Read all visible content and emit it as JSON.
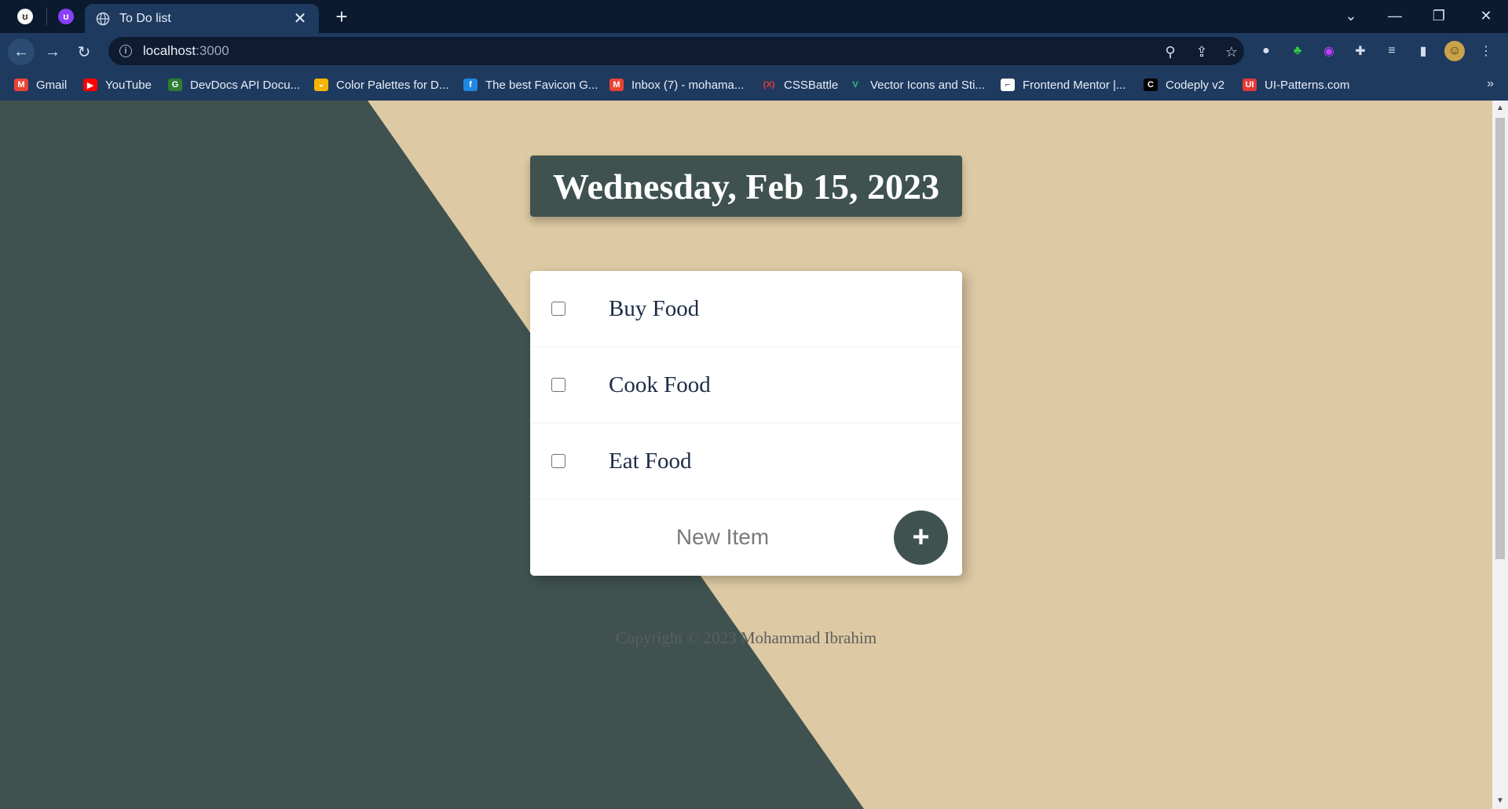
{
  "browser": {
    "tab_title": "To Do list",
    "url_host": "localhost",
    "url_port": ":3000",
    "bookmarks": [
      {
        "label": "Gmail",
        "icon": "gmail-icon",
        "color": "#ea4335"
      },
      {
        "label": "YouTube",
        "icon": "youtube-icon",
        "color": "#ff0000"
      },
      {
        "label": "DevDocs API Docu...",
        "icon": "devdocs-icon",
        "color": "#2e7d32"
      },
      {
        "label": "Color Palettes for D...",
        "icon": "color-palettes-icon",
        "color": "#f4b400"
      },
      {
        "label": "The best Favicon G...",
        "icon": "favicon-icon",
        "color": "#1e88e5"
      },
      {
        "label": "Inbox (7) - mohama...",
        "icon": "gmail-icon",
        "color": "#ea4335"
      },
      {
        "label": "CSSBattle",
        "icon": "cssbattle-icon",
        "color": "#e53935"
      },
      {
        "label": "Vector Icons and Sti...",
        "icon": "vector-icons-icon",
        "color": "#2ec27e"
      },
      {
        "label": "Frontend Mentor |...",
        "icon": "frontend-mentor-icon",
        "color": "#ffffff"
      },
      {
        "label": "Codeply v2",
        "icon": "codeply-icon",
        "color": "#000000"
      },
      {
        "label": "UI-Patterns.com",
        "icon": "ui-patterns-icon",
        "color": "#e53935"
      }
    ]
  },
  "page": {
    "date_title": "Wednesday, Feb 15, 2023",
    "items": [
      {
        "label": "Buy Food",
        "checked": false
      },
      {
        "label": "Cook Food",
        "checked": false
      },
      {
        "label": "Eat Food",
        "checked": false
      }
    ],
    "new_item_placeholder": "New Item",
    "add_button_label": "+",
    "footer": "Copyright © 2023 Mohammad Ibrahim"
  },
  "colors": {
    "dark_green": "#3f524f",
    "sand": "#ddc9a3",
    "text_navy": "#1d2b46"
  }
}
